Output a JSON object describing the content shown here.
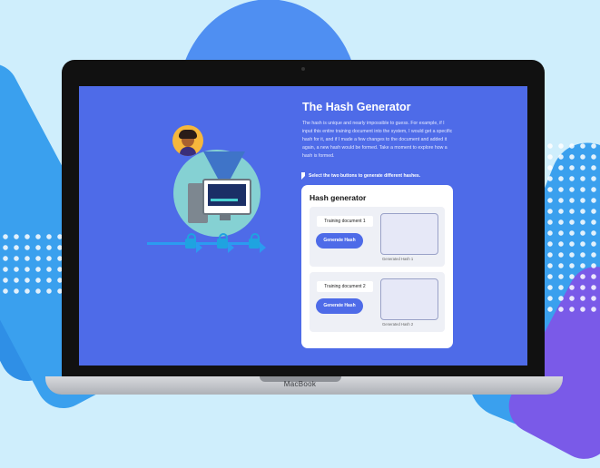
{
  "device": {
    "label": "MacBook"
  },
  "page": {
    "title": "The Hash Generator",
    "description": "The hash is unique and nearly impossible to guess. For example, if I input this entire training document into the system, I would get a specific hash for it, and if I made a few changes to the document and added it again, a new hash would be formed. Take a moment to explore how a hash is formed.",
    "instruction": "Select the two buttons to generate different hashes."
  },
  "card": {
    "title": "Hash generator",
    "rows": [
      {
        "document": "Training document 1",
        "button": "Generate Hash",
        "hash_label": "Generated Hash 1"
      },
      {
        "document": "Training document 2",
        "button": "Generate Hash",
        "hash_label": "Generated Hash 2"
      }
    ]
  },
  "colors": {
    "screen": "#4e6be8",
    "accent": "#4e6be8",
    "background": "#cfeefc"
  },
  "icons": [
    "avatar",
    "computer-illustration",
    "lock-icon",
    "cursor-icon"
  ]
}
